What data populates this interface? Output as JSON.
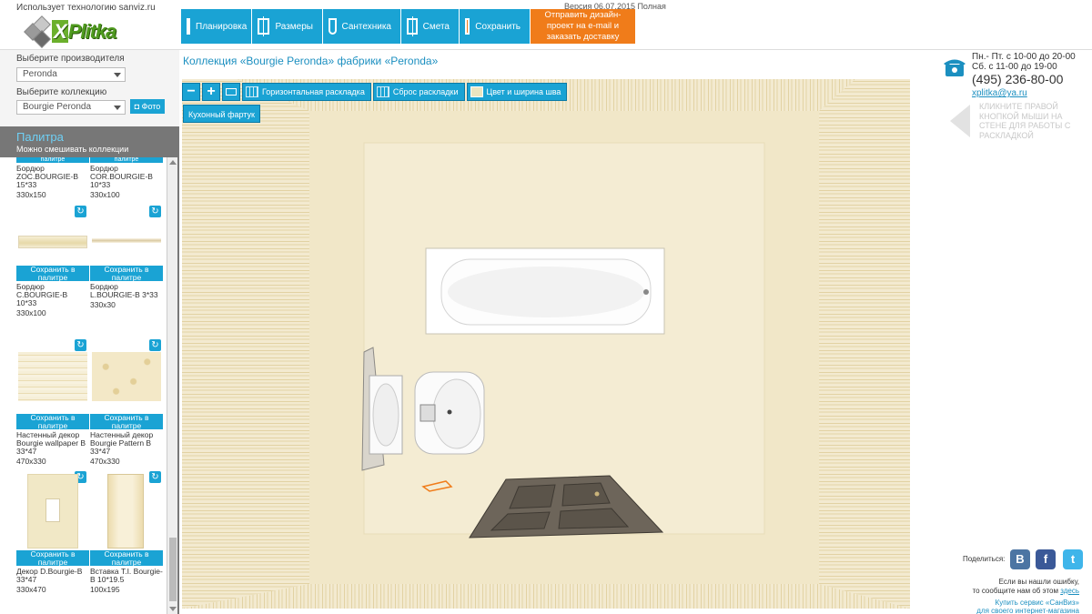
{
  "header": {
    "tech_text": "Использует технологию sanviz.ru",
    "logo_text": "Plitka",
    "logo_x": "X",
    "version": "Версия 06.07.2015 Полная",
    "nav": [
      {
        "label": "Планировка",
        "icon": "floorplan-icon"
      },
      {
        "label": "Размеры",
        "icon": "dimensions-icon"
      },
      {
        "label": "Сантехника",
        "icon": "plumbing-icon"
      },
      {
        "label": "Смета",
        "icon": "estimate-icon"
      },
      {
        "label": "Сохранить",
        "icon": "save-icon"
      }
    ],
    "send_button": "Отправить дизайн-проект на e-mail и заказать доставку"
  },
  "sidebar": {
    "manufacturer_label": "Выберите производителя",
    "manufacturer_value": "Peronda",
    "collection_label": "Выберите коллекцию",
    "collection_value": "Bourgie Peronda",
    "photo_button": "Фото",
    "palette_title": "Палитра",
    "palette_subtitle": "Можно смешивать коллекции",
    "save_label": "Сохранить в палитре",
    "top_partial_save": "палитре",
    "tiles": [
      {
        "name": "Бордюр ZOC.BOURGIE-B 15*33",
        "size": "330x150"
      },
      {
        "name": "Бордюр COR.BOURGIE-B 10*33",
        "size": "330x100"
      },
      {
        "name": "Бордюр C.BOURGIE-B 10*33",
        "size": "330x100"
      },
      {
        "name": "Бордюр L.BOURGIE-B 3*33",
        "size": "330x30"
      },
      {
        "name": "Настенный декор Bourgie wallpaper B 33*47",
        "size": "470x330"
      },
      {
        "name": "Настенный декор Bourgie Pattern B 33*47",
        "size": "470x330"
      },
      {
        "name": "Декор D.Bourgie-B 33*47",
        "size": "330x470"
      },
      {
        "name": "Вставка T.I. Bourgie-B 10*19.5",
        "size": "100x195"
      }
    ]
  },
  "main": {
    "title": "Коллекция «Bourgie Peronda» фабрики «Peronda»",
    "toolbar": {
      "zoom_out": "−",
      "zoom_in": "+",
      "horizontal_layout": "Горизонтальная раскладка",
      "reset_layout": "Сброс раскладки",
      "color_width": "Цвет и ширина шва",
      "kitchen": "Кухонный фартук"
    }
  },
  "right": {
    "hours_weekdays": "Пн.- Пт. с 10-00 до 20-00",
    "hours_saturday": "Сб. с 11-00 до 19-00",
    "phone": "(495) 236-80-00",
    "email": "xplitka@ya.ru",
    "hint": "КЛИКНИТЕ ПРАВОЙ КНОПКОЙ МЫШИ НА СТЕНЕ ДЛЯ РАБОТЫ С РАСКЛАДКОЙ",
    "share_label": "Поделиться:",
    "social": {
      "vk": "В",
      "fb": "f",
      "tw": "t"
    },
    "error_line1": "Если вы нашли ошибку,",
    "error_line2": "то сообщите нам об этом",
    "error_link": "здесь",
    "buy_line1": "Купить сервис «СанВиз»",
    "buy_line2": "для своего интернет-магазина"
  },
  "colors": {
    "accent": "#1aa3d4",
    "orange": "#f07c1a",
    "tile_beige": "#f0e6c8"
  }
}
